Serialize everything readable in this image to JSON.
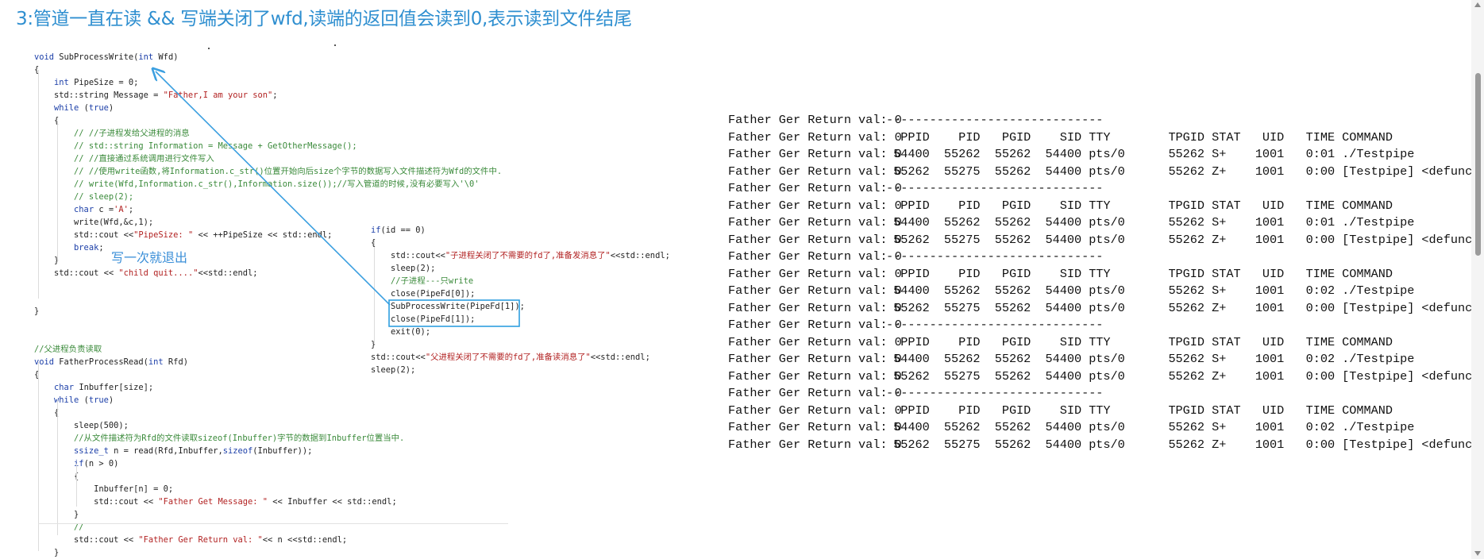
{
  "heading": "3:管道一直在读 && 写端关闭了wfd,读端的返回值会读到0,表示读到文件结尾",
  "annotation": "写一次就退出",
  "colors": {
    "heading": "#2f8fd0",
    "arrow": "#3b9fe0",
    "highlight_box": "#2f9fe0"
  },
  "code_left": [
    [
      "void SubProcessWrite(int Wfd)"
    ],
    [
      "{"
    ],
    [
      "    int PipeSize = 0;"
    ],
    [
      "    std::string Message = \"Father,I am your son\";"
    ],
    [
      "    while (true)"
    ],
    [
      "    {"
    ],
    [
      "        // //子进程发给父进程的消息"
    ],
    [
      "        // std::string Information = Message + GetOtherMessage();"
    ],
    [
      "        // //直接通过系统调用进行文件写入"
    ],
    [
      "        // //使用write函数,将Information.c_str()位置开始向后size个字节的数据写入文件描述符为Wfd的文件中."
    ],
    [
      "        // write(Wfd,Information.c_str(),Information.size());//写入管道的时候,没有必要写入'\\0'"
    ],
    [
      "        // sleep(2);"
    ],
    [
      "        char c ='A';"
    ],
    [
      "        write(Wfd,&c,1);"
    ],
    [
      "        std::cout <<\"PipeSize: \" << ++PipeSize << std::endl;"
    ],
    [
      "        break;"
    ],
    [
      "    }"
    ],
    [
      "    std::cout << \"child quit....\"<<std::endl;"
    ],
    [
      ""
    ],
    [
      ""
    ],
    [
      "}"
    ],
    [
      ""
    ],
    [
      ""
    ],
    [
      "//父进程负责读取"
    ],
    [
      "void FatherProcessRead(int Rfd)"
    ],
    [
      "{"
    ],
    [
      "    char Inbuffer[size];"
    ],
    [
      "    while (true)"
    ],
    [
      "    {"
    ],
    [
      "        sleep(500);"
    ],
    [
      "        //从文件描述符为Rfd的文件读取sizeof(Inbuffer)字节的数据到Inbuffer位置当中."
    ],
    [
      "        ssize_t n = read(Rfd,Inbuffer,sizeof(Inbuffer));"
    ],
    [
      "        if(n > 0)"
    ],
    [
      "        {"
    ],
    [
      "            Inbuffer[n] = 0;"
    ],
    [
      "            std::cout << \"Father Get Message: \" << Inbuffer << std::endl;"
    ],
    [
      "        }"
    ],
    [
      "        //"
    ],
    [
      "        std::cout << \"Father Ger Return val: \"<< n <<std::endl;"
    ],
    [
      "    }"
    ]
  ],
  "code_middle": [
    "if(id == 0)",
    "{",
    "    std::cout<<\"子进程关闭了不需要的fd了,准备发消息了\"<<std::endl;",
    "    sleep(2);",
    "    //子进程---只write",
    "    close(PipeFd[0]);",
    "    SubProcessWrite(PipeFd[1]);",
    "    close(PipeFd[1]);",
    "    exit(0);",
    "}",
    "std::cout<<\"父进程关闭了不需要的fd了,准备读消息了\"<<std::endl;",
    "sleep(2);"
  ],
  "terminal_lines": [
    "Father Ger Return val: 0",
    "Father Ger Return val: 0",
    "Father Ger Return val: 0",
    "Father Ger Return val: 0",
    "Father Ger Return val: 0",
    "Father Ger Return val: 0",
    "Father Ger Return val: 0",
    "Father Ger Return val: 0",
    "Father Ger Return val: 0",
    "Father Ger Return val: 0",
    "Father Ger Return val: 0",
    "Father Ger Return val: 0",
    "Father Ger Return val: 0",
    "Father Ger Return val: 0",
    "Father Ger Return val: 0",
    "Father Ger Return val: 0",
    "Father Ger Return val: 0",
    "Father Ger Return val: 0",
    "Father Ger Return val: 0",
    "Father Ger Return val: 0"
  ],
  "ps_lines": [
    "------------------------------",
    "  PPID    PID   PGID    SID TTY        TPGID STAT   UID   TIME COMMAND",
    " 54400  55262  55262  54400 pts/0      55262 S+    1001   0:01 ./Testpipe",
    " 55262  55275  55262  54400 pts/0      55262 Z+    1001   0:00 [Testpipe] <defunct>",
    "------------------------------",
    "  PPID    PID   PGID    SID TTY        TPGID STAT   UID   TIME COMMAND",
    " 54400  55262  55262  54400 pts/0      55262 S+    1001   0:01 ./Testpipe",
    " 55262  55275  55262  54400 pts/0      55262 Z+    1001   0:00 [Testpipe] <defunct>",
    "------------------------------",
    "  PPID    PID   PGID    SID TTY        TPGID STAT   UID   TIME COMMAND",
    " 54400  55262  55262  54400 pts/0      55262 S+    1001   0:02 ./Testpipe",
    " 55262  55275  55262  54400 pts/0      55262 Z+    1001   0:00 [Testpipe] <defunct>",
    "------------------------------",
    "  PPID    PID   PGID    SID TTY        TPGID STAT   UID   TIME COMMAND",
    " 54400  55262  55262  54400 pts/0      55262 S+    1001   0:02 ./Testpipe",
    " 55262  55275  55262  54400 pts/0      55262 Z+    1001   0:00 [Testpipe] <defunct>",
    "------------------------------",
    "  PPID    PID   PGID    SID TTY        TPGID STAT   UID   TIME COMMAND",
    " 54400  55262  55262  54400 pts/0      55262 S+    1001   0:02 ./Testpipe",
    " 55262  55275  55262  54400 pts/0      55262 Z+    1001   0:00 [Testpipe] <defunct>"
  ]
}
